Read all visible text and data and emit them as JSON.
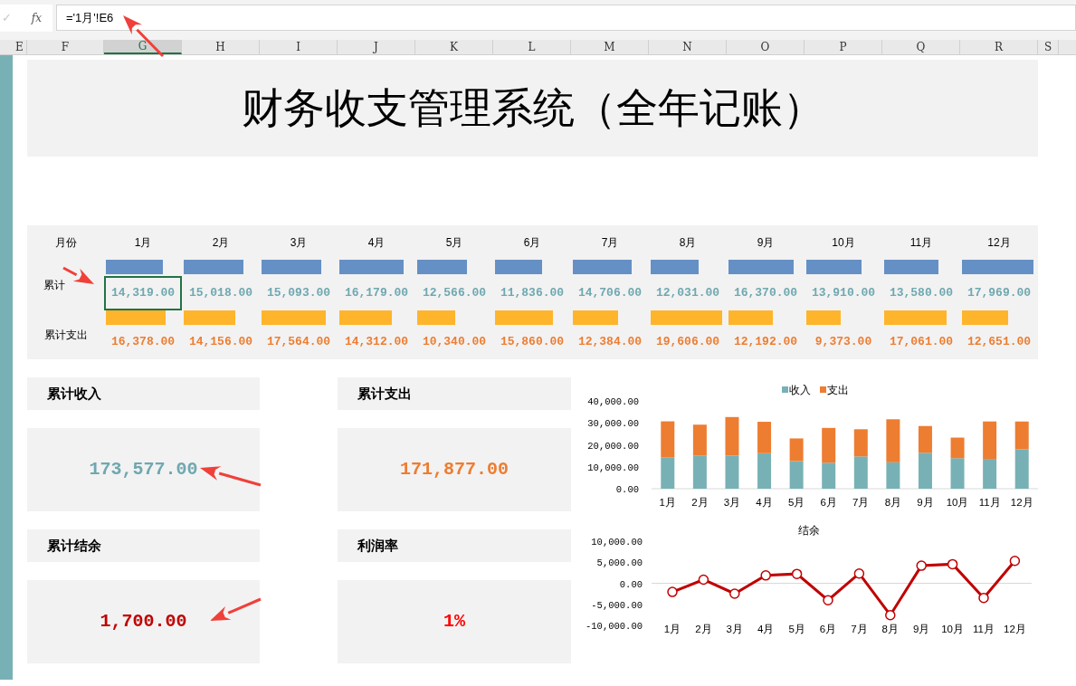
{
  "formula_bar": {
    "confirm": "✓",
    "fx": "fx",
    "formula": "='1月'!E6"
  },
  "columns": [
    {
      "label": "E",
      "selected": false
    },
    {
      "label": "F",
      "selected": false
    },
    {
      "label": "G",
      "selected": true
    },
    {
      "label": "H",
      "selected": false
    },
    {
      "label": "I",
      "selected": false
    },
    {
      "label": "J",
      "selected": false
    },
    {
      "label": "K",
      "selected": false
    },
    {
      "label": "L",
      "selected": false
    },
    {
      "label": "M",
      "selected": false
    },
    {
      "label": "N",
      "selected": false
    },
    {
      "label": "O",
      "selected": false
    },
    {
      "label": "P",
      "selected": false
    },
    {
      "label": "Q",
      "selected": false
    },
    {
      "label": "R",
      "selected": false
    },
    {
      "label": "S",
      "selected": false
    }
  ],
  "title": "财务收支管理系统（全年记账）",
  "table": {
    "header": "月份",
    "income_label": "累计",
    "expense_label": "累计支出",
    "months": [
      {
        "month": "1月",
        "income": {
          "value": "14,319.00",
          "level": 0.8
        },
        "expense": {
          "value": "16,378.00",
          "level": 0.84
        },
        "selected": true
      },
      {
        "month": "2月",
        "income": {
          "value": "15,018.00",
          "level": 0.84
        },
        "expense": {
          "value": "14,156.00",
          "level": 0.72
        },
        "selected": false
      },
      {
        "month": "3月",
        "income": {
          "value": "15,093.00",
          "level": 0.84
        },
        "expense": {
          "value": "17,564.00",
          "level": 0.9
        },
        "selected": false
      },
      {
        "month": "4月",
        "income": {
          "value": "16,179.00",
          "level": 0.9
        },
        "expense": {
          "value": "14,312.00",
          "level": 0.73
        },
        "selected": false
      },
      {
        "month": "5月",
        "income": {
          "value": "12,566.00",
          "level": 0.7
        },
        "expense": {
          "value": "10,340.00",
          "level": 0.53
        },
        "selected": false
      },
      {
        "month": "6月",
        "income": {
          "value": "11,836.00",
          "level": 0.66
        },
        "expense": {
          "value": "15,860.00",
          "level": 0.81
        },
        "selected": false
      },
      {
        "month": "7月",
        "income": {
          "value": "14,706.00",
          "level": 0.82
        },
        "expense": {
          "value": "12,384.00",
          "level": 0.63
        },
        "selected": false
      },
      {
        "month": "8月",
        "income": {
          "value": "12,031.00",
          "level": 0.67
        },
        "expense": {
          "value": "19,606.00",
          "level": 1
        },
        "selected": false
      },
      {
        "month": "9月",
        "income": {
          "value": "16,370.00",
          "level": 0.91
        },
        "expense": {
          "value": "12,192.00",
          "level": 0.62
        },
        "selected": false
      },
      {
        "month": "10月",
        "income": {
          "value": "13,910.00",
          "level": 0.77
        },
        "expense": {
          "value": "9,373.00",
          "level": 0.48
        },
        "selected": false
      },
      {
        "month": "11月",
        "income": {
          "value": "13,580.00",
          "level": 0.76
        },
        "expense": {
          "value": "17,061.00",
          "level": 0.87
        },
        "selected": false
      },
      {
        "month": "12月",
        "income": {
          "value": "17,969.00",
          "level": 1
        },
        "expense": {
          "value": "12,651.00",
          "level": 0.65
        },
        "selected": false
      }
    ]
  },
  "cards": [
    {
      "label": "累计收入",
      "value": "173,577.00",
      "color": "#6fa8b0"
    },
    {
      "label": "累计支出",
      "value": "171,877.00",
      "color": "#ed7d31"
    },
    {
      "label": "累计结余",
      "value": "1,700.00",
      "color": "#c00000"
    },
    {
      "label": "利润率",
      "value": "1%",
      "color": "#ff0000"
    }
  ],
  "charts": [
    {
      "chart_data": {
        "type": "bar",
        "stacked": true,
        "legend": "top",
        "categories": [
          "1月",
          "2月",
          "3月",
          "4月",
          "5月",
          "6月",
          "7月",
          "8月",
          "9月",
          "10月",
          "11月",
          "12月"
        ],
        "series": [
          {
            "name": "收入",
            "color": "#78b1b5",
            "values": [
              14319,
              15018,
              15093,
              16179,
              12566,
              11836,
              14706,
              12031,
              16370,
              13910,
              13580,
              17969
            ]
          },
          {
            "name": "支出",
            "color": "#ed7d31",
            "values": [
              16378,
              14156,
              17564,
              14312,
              10340,
              15860,
              12384,
              19606,
              12192,
              9373,
              17061,
              12651
            ]
          }
        ],
        "ylim": [
          0,
          40000
        ],
        "yticks": [
          {
            "value": 0,
            "label": "0.00"
          },
          {
            "value": 10000,
            "label": "10,000.00"
          },
          {
            "value": 20000,
            "label": "20,000.00"
          },
          {
            "value": 30000,
            "label": "30,000.00"
          },
          {
            "value": 40000,
            "label": "40,000.00"
          }
        ]
      }
    },
    {
      "chart_data": {
        "type": "line",
        "title": "结余",
        "categories": [
          "1月",
          "2月",
          "3月",
          "4月",
          "5月",
          "6月",
          "7月",
          "8月",
          "9月",
          "10月",
          "11月",
          "12月"
        ],
        "series": [
          {
            "color": "#c00000",
            "marker": "circle",
            "values": [
              -2059,
              862,
              -2471,
              1867,
              2226,
              -4024,
              2322,
              -7575,
              4178,
              4537,
              -3481,
              5318
            ]
          }
        ],
        "ylim": [
          -10000,
          10000
        ],
        "yticks": [
          {
            "value": -10000,
            "label": "-10,000.00"
          },
          {
            "value": -5000,
            "label": "-5,000.00"
          },
          {
            "value": 0,
            "label": "0.00"
          },
          {
            "value": 5000,
            "label": "5,000.00"
          },
          {
            "value": 10000,
            "label": "10,000.00"
          }
        ]
      }
    }
  ]
}
